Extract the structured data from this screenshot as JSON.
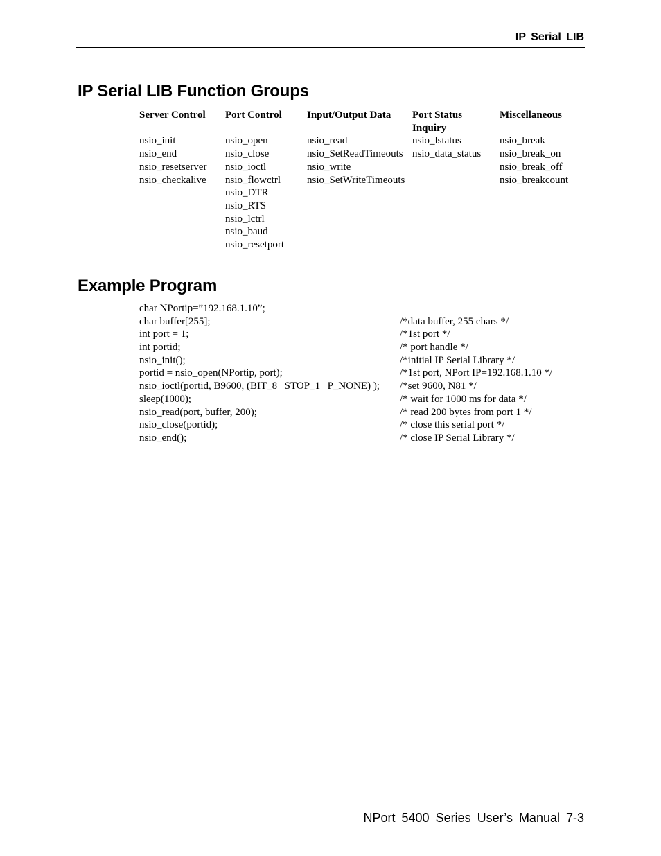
{
  "header": {
    "running_title": "IP Serial LIB"
  },
  "function_groups": {
    "heading": "IP Serial LIB Function Groups",
    "columns": [
      {
        "title": "Server Control",
        "items": [
          "nsio_init",
          "nsio_end",
          "nsio_resetserver",
          "nsio_checkalive"
        ]
      },
      {
        "title": "Port Control",
        "items": [
          "nsio_open",
          "nsio_close",
          "nsio_ioctl",
          "nsio_flowctrl",
          "nsio_DTR",
          "nsio_RTS",
          "nsio_lctrl",
          "nsio_baud",
          "nsio_resetport"
        ]
      },
      {
        "title": "Input/Output Data",
        "items": [
          "nsio_read",
          "nsio_SetReadTimeouts",
          "nsio_write",
          "nsio_SetWriteTimeouts"
        ]
      },
      {
        "title_line1": "Port Status",
        "title_line2": "Inquiry",
        "items": [
          "nsio_lstatus",
          "nsio_data_status"
        ]
      },
      {
        "title": "Miscellaneous",
        "items": [
          "nsio_break",
          "nsio_break_on",
          "nsio_break_off",
          "nsio_breakcount"
        ]
      }
    ]
  },
  "example_program": {
    "heading": "Example Program",
    "lines": [
      {
        "code": "char NPortip=”192.168.1.10”;",
        "comment": ""
      },
      {
        "code": "char buffer[255];",
        "comment": "/*data buffer, 255 chars */"
      },
      {
        "code": "int port = 1;",
        "comment": "/*1st port */"
      },
      {
        "code": "int portid;",
        "comment": "/* port handle */"
      },
      {
        "code": "nsio_init();",
        "comment": "/*initial IP Serial Library */"
      },
      {
        "code": "portid = nsio_open(NPortip, port);",
        "comment": "/*1st port, NPort IP=192.168.1.10 */"
      },
      {
        "code": "nsio_ioctl(portid, B9600, (BIT_8 | STOP_1 | P_NONE) );",
        "comment": "/*set 9600, N81 */"
      },
      {
        "code": "sleep(1000);",
        "comment": "/* wait for 1000 ms for data */"
      },
      {
        "code": "nsio_read(port, buffer, 200);",
        "comment": "/* read 200 bytes from port 1 */"
      },
      {
        "code": "nsio_close(portid);",
        "comment": "/* close this serial port */"
      },
      {
        "code": "nsio_end();",
        "comment": "/* close IP Serial Library */"
      }
    ]
  },
  "footer": {
    "running_footer": "NPort 5400 Series User’s Manual 7-3"
  }
}
